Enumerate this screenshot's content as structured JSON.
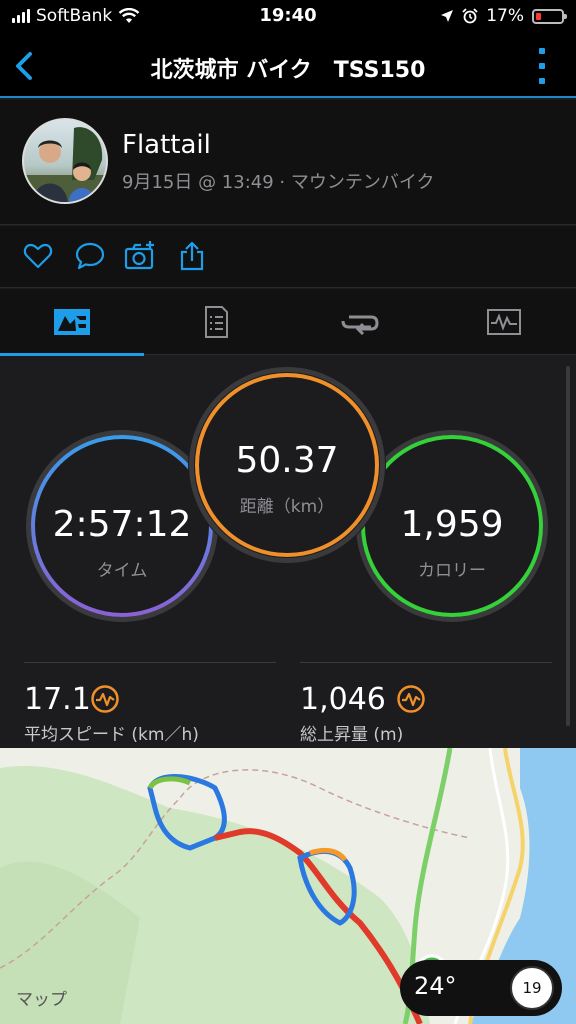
{
  "status_bar": {
    "carrier": "SoftBank",
    "time": "19:40",
    "battery_pct": "17%",
    "icons": [
      "signal-icon",
      "wifi-icon",
      "location-arrow-icon",
      "alarm-icon",
      "battery-icon"
    ]
  },
  "nav": {
    "title": "北茨城市 バイク　TSS150",
    "back_icon": "chevron-left-icon",
    "more_icon": "more-vertical-icon"
  },
  "profile": {
    "name": "Flattail",
    "meta": "9月15日 @ 13:49 · マウンテンバイク"
  },
  "actions": [
    "heart-icon",
    "comment-icon",
    "camera-add-icon",
    "share-icon"
  ],
  "tabs": [
    {
      "icon": "overview-icon",
      "active": true
    },
    {
      "icon": "details-icon",
      "active": false
    },
    {
      "icon": "laps-icon",
      "active": false
    },
    {
      "icon": "chart-icon",
      "active": false
    }
  ],
  "stats": {
    "time": {
      "value": "2:57:12",
      "label": "タイム"
    },
    "distance": {
      "value": "50.37",
      "label": "距離（km）"
    },
    "calories": {
      "value": "1,959",
      "label": "カロリー"
    },
    "avg_speed": {
      "value": "17.1",
      "label": "平均スピード (km／h)"
    },
    "elevation": {
      "value": "1,046",
      "label": "総上昇量 (m)"
    }
  },
  "map": {
    "attribution": "マップ",
    "temperature": "24°",
    "badge": "19"
  },
  "colors": {
    "accent": "#1e9de8",
    "time_ring_top": "#3a9ce8",
    "time_ring_bottom": "#8a62d4",
    "distance_ring": "#f0902a",
    "calorie_ring": "#35d13a"
  }
}
